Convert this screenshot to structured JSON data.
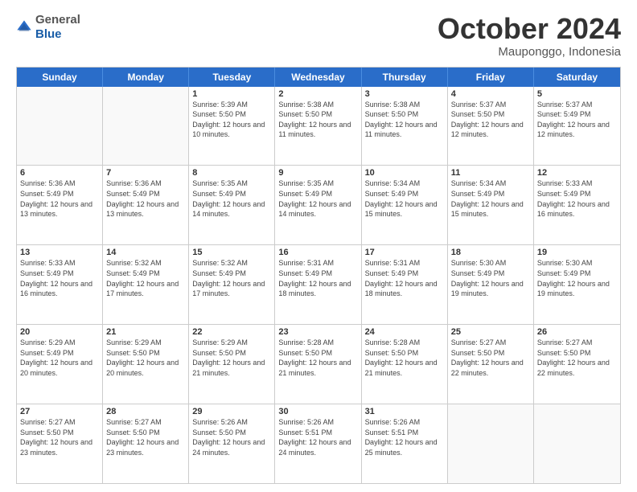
{
  "header": {
    "logo": {
      "general": "General",
      "blue": "Blue"
    },
    "title": "October 2024",
    "location": "Mauponggo, Indonesia"
  },
  "days_of_week": [
    "Sunday",
    "Monday",
    "Tuesday",
    "Wednesday",
    "Thursday",
    "Friday",
    "Saturday"
  ],
  "weeks": [
    [
      {
        "day": "",
        "sunrise": "",
        "sunset": "",
        "daylight": ""
      },
      {
        "day": "",
        "sunrise": "",
        "sunset": "",
        "daylight": ""
      },
      {
        "day": "1",
        "sunrise": "Sunrise: 5:39 AM",
        "sunset": "Sunset: 5:50 PM",
        "daylight": "Daylight: 12 hours and 10 minutes."
      },
      {
        "day": "2",
        "sunrise": "Sunrise: 5:38 AM",
        "sunset": "Sunset: 5:50 PM",
        "daylight": "Daylight: 12 hours and 11 minutes."
      },
      {
        "day": "3",
        "sunrise": "Sunrise: 5:38 AM",
        "sunset": "Sunset: 5:50 PM",
        "daylight": "Daylight: 12 hours and 11 minutes."
      },
      {
        "day": "4",
        "sunrise": "Sunrise: 5:37 AM",
        "sunset": "Sunset: 5:50 PM",
        "daylight": "Daylight: 12 hours and 12 minutes."
      },
      {
        "day": "5",
        "sunrise": "Sunrise: 5:37 AM",
        "sunset": "Sunset: 5:49 PM",
        "daylight": "Daylight: 12 hours and 12 minutes."
      }
    ],
    [
      {
        "day": "6",
        "sunrise": "Sunrise: 5:36 AM",
        "sunset": "Sunset: 5:49 PM",
        "daylight": "Daylight: 12 hours and 13 minutes."
      },
      {
        "day": "7",
        "sunrise": "Sunrise: 5:36 AM",
        "sunset": "Sunset: 5:49 PM",
        "daylight": "Daylight: 12 hours and 13 minutes."
      },
      {
        "day": "8",
        "sunrise": "Sunrise: 5:35 AM",
        "sunset": "Sunset: 5:49 PM",
        "daylight": "Daylight: 12 hours and 14 minutes."
      },
      {
        "day": "9",
        "sunrise": "Sunrise: 5:35 AM",
        "sunset": "Sunset: 5:49 PM",
        "daylight": "Daylight: 12 hours and 14 minutes."
      },
      {
        "day": "10",
        "sunrise": "Sunrise: 5:34 AM",
        "sunset": "Sunset: 5:49 PM",
        "daylight": "Daylight: 12 hours and 15 minutes."
      },
      {
        "day": "11",
        "sunrise": "Sunrise: 5:34 AM",
        "sunset": "Sunset: 5:49 PM",
        "daylight": "Daylight: 12 hours and 15 minutes."
      },
      {
        "day": "12",
        "sunrise": "Sunrise: 5:33 AM",
        "sunset": "Sunset: 5:49 PM",
        "daylight": "Daylight: 12 hours and 16 minutes."
      }
    ],
    [
      {
        "day": "13",
        "sunrise": "Sunrise: 5:33 AM",
        "sunset": "Sunset: 5:49 PM",
        "daylight": "Daylight: 12 hours and 16 minutes."
      },
      {
        "day": "14",
        "sunrise": "Sunrise: 5:32 AM",
        "sunset": "Sunset: 5:49 PM",
        "daylight": "Daylight: 12 hours and 17 minutes."
      },
      {
        "day": "15",
        "sunrise": "Sunrise: 5:32 AM",
        "sunset": "Sunset: 5:49 PM",
        "daylight": "Daylight: 12 hours and 17 minutes."
      },
      {
        "day": "16",
        "sunrise": "Sunrise: 5:31 AM",
        "sunset": "Sunset: 5:49 PM",
        "daylight": "Daylight: 12 hours and 18 minutes."
      },
      {
        "day": "17",
        "sunrise": "Sunrise: 5:31 AM",
        "sunset": "Sunset: 5:49 PM",
        "daylight": "Daylight: 12 hours and 18 minutes."
      },
      {
        "day": "18",
        "sunrise": "Sunrise: 5:30 AM",
        "sunset": "Sunset: 5:49 PM",
        "daylight": "Daylight: 12 hours and 19 minutes."
      },
      {
        "day": "19",
        "sunrise": "Sunrise: 5:30 AM",
        "sunset": "Sunset: 5:49 PM",
        "daylight": "Daylight: 12 hours and 19 minutes."
      }
    ],
    [
      {
        "day": "20",
        "sunrise": "Sunrise: 5:29 AM",
        "sunset": "Sunset: 5:49 PM",
        "daylight": "Daylight: 12 hours and 20 minutes."
      },
      {
        "day": "21",
        "sunrise": "Sunrise: 5:29 AM",
        "sunset": "Sunset: 5:50 PM",
        "daylight": "Daylight: 12 hours and 20 minutes."
      },
      {
        "day": "22",
        "sunrise": "Sunrise: 5:29 AM",
        "sunset": "Sunset: 5:50 PM",
        "daylight": "Daylight: 12 hours and 21 minutes."
      },
      {
        "day": "23",
        "sunrise": "Sunrise: 5:28 AM",
        "sunset": "Sunset: 5:50 PM",
        "daylight": "Daylight: 12 hours and 21 minutes."
      },
      {
        "day": "24",
        "sunrise": "Sunrise: 5:28 AM",
        "sunset": "Sunset: 5:50 PM",
        "daylight": "Daylight: 12 hours and 21 minutes."
      },
      {
        "day": "25",
        "sunrise": "Sunrise: 5:27 AM",
        "sunset": "Sunset: 5:50 PM",
        "daylight": "Daylight: 12 hours and 22 minutes."
      },
      {
        "day": "26",
        "sunrise": "Sunrise: 5:27 AM",
        "sunset": "Sunset: 5:50 PM",
        "daylight": "Daylight: 12 hours and 22 minutes."
      }
    ],
    [
      {
        "day": "27",
        "sunrise": "Sunrise: 5:27 AM",
        "sunset": "Sunset: 5:50 PM",
        "daylight": "Daylight: 12 hours and 23 minutes."
      },
      {
        "day": "28",
        "sunrise": "Sunrise: 5:27 AM",
        "sunset": "Sunset: 5:50 PM",
        "daylight": "Daylight: 12 hours and 23 minutes."
      },
      {
        "day": "29",
        "sunrise": "Sunrise: 5:26 AM",
        "sunset": "Sunset: 5:50 PM",
        "daylight": "Daylight: 12 hours and 24 minutes."
      },
      {
        "day": "30",
        "sunrise": "Sunrise: 5:26 AM",
        "sunset": "Sunset: 5:51 PM",
        "daylight": "Daylight: 12 hours and 24 minutes."
      },
      {
        "day": "31",
        "sunrise": "Sunrise: 5:26 AM",
        "sunset": "Sunset: 5:51 PM",
        "daylight": "Daylight: 12 hours and 25 minutes."
      },
      {
        "day": "",
        "sunrise": "",
        "sunset": "",
        "daylight": ""
      },
      {
        "day": "",
        "sunrise": "",
        "sunset": "",
        "daylight": ""
      }
    ]
  ]
}
